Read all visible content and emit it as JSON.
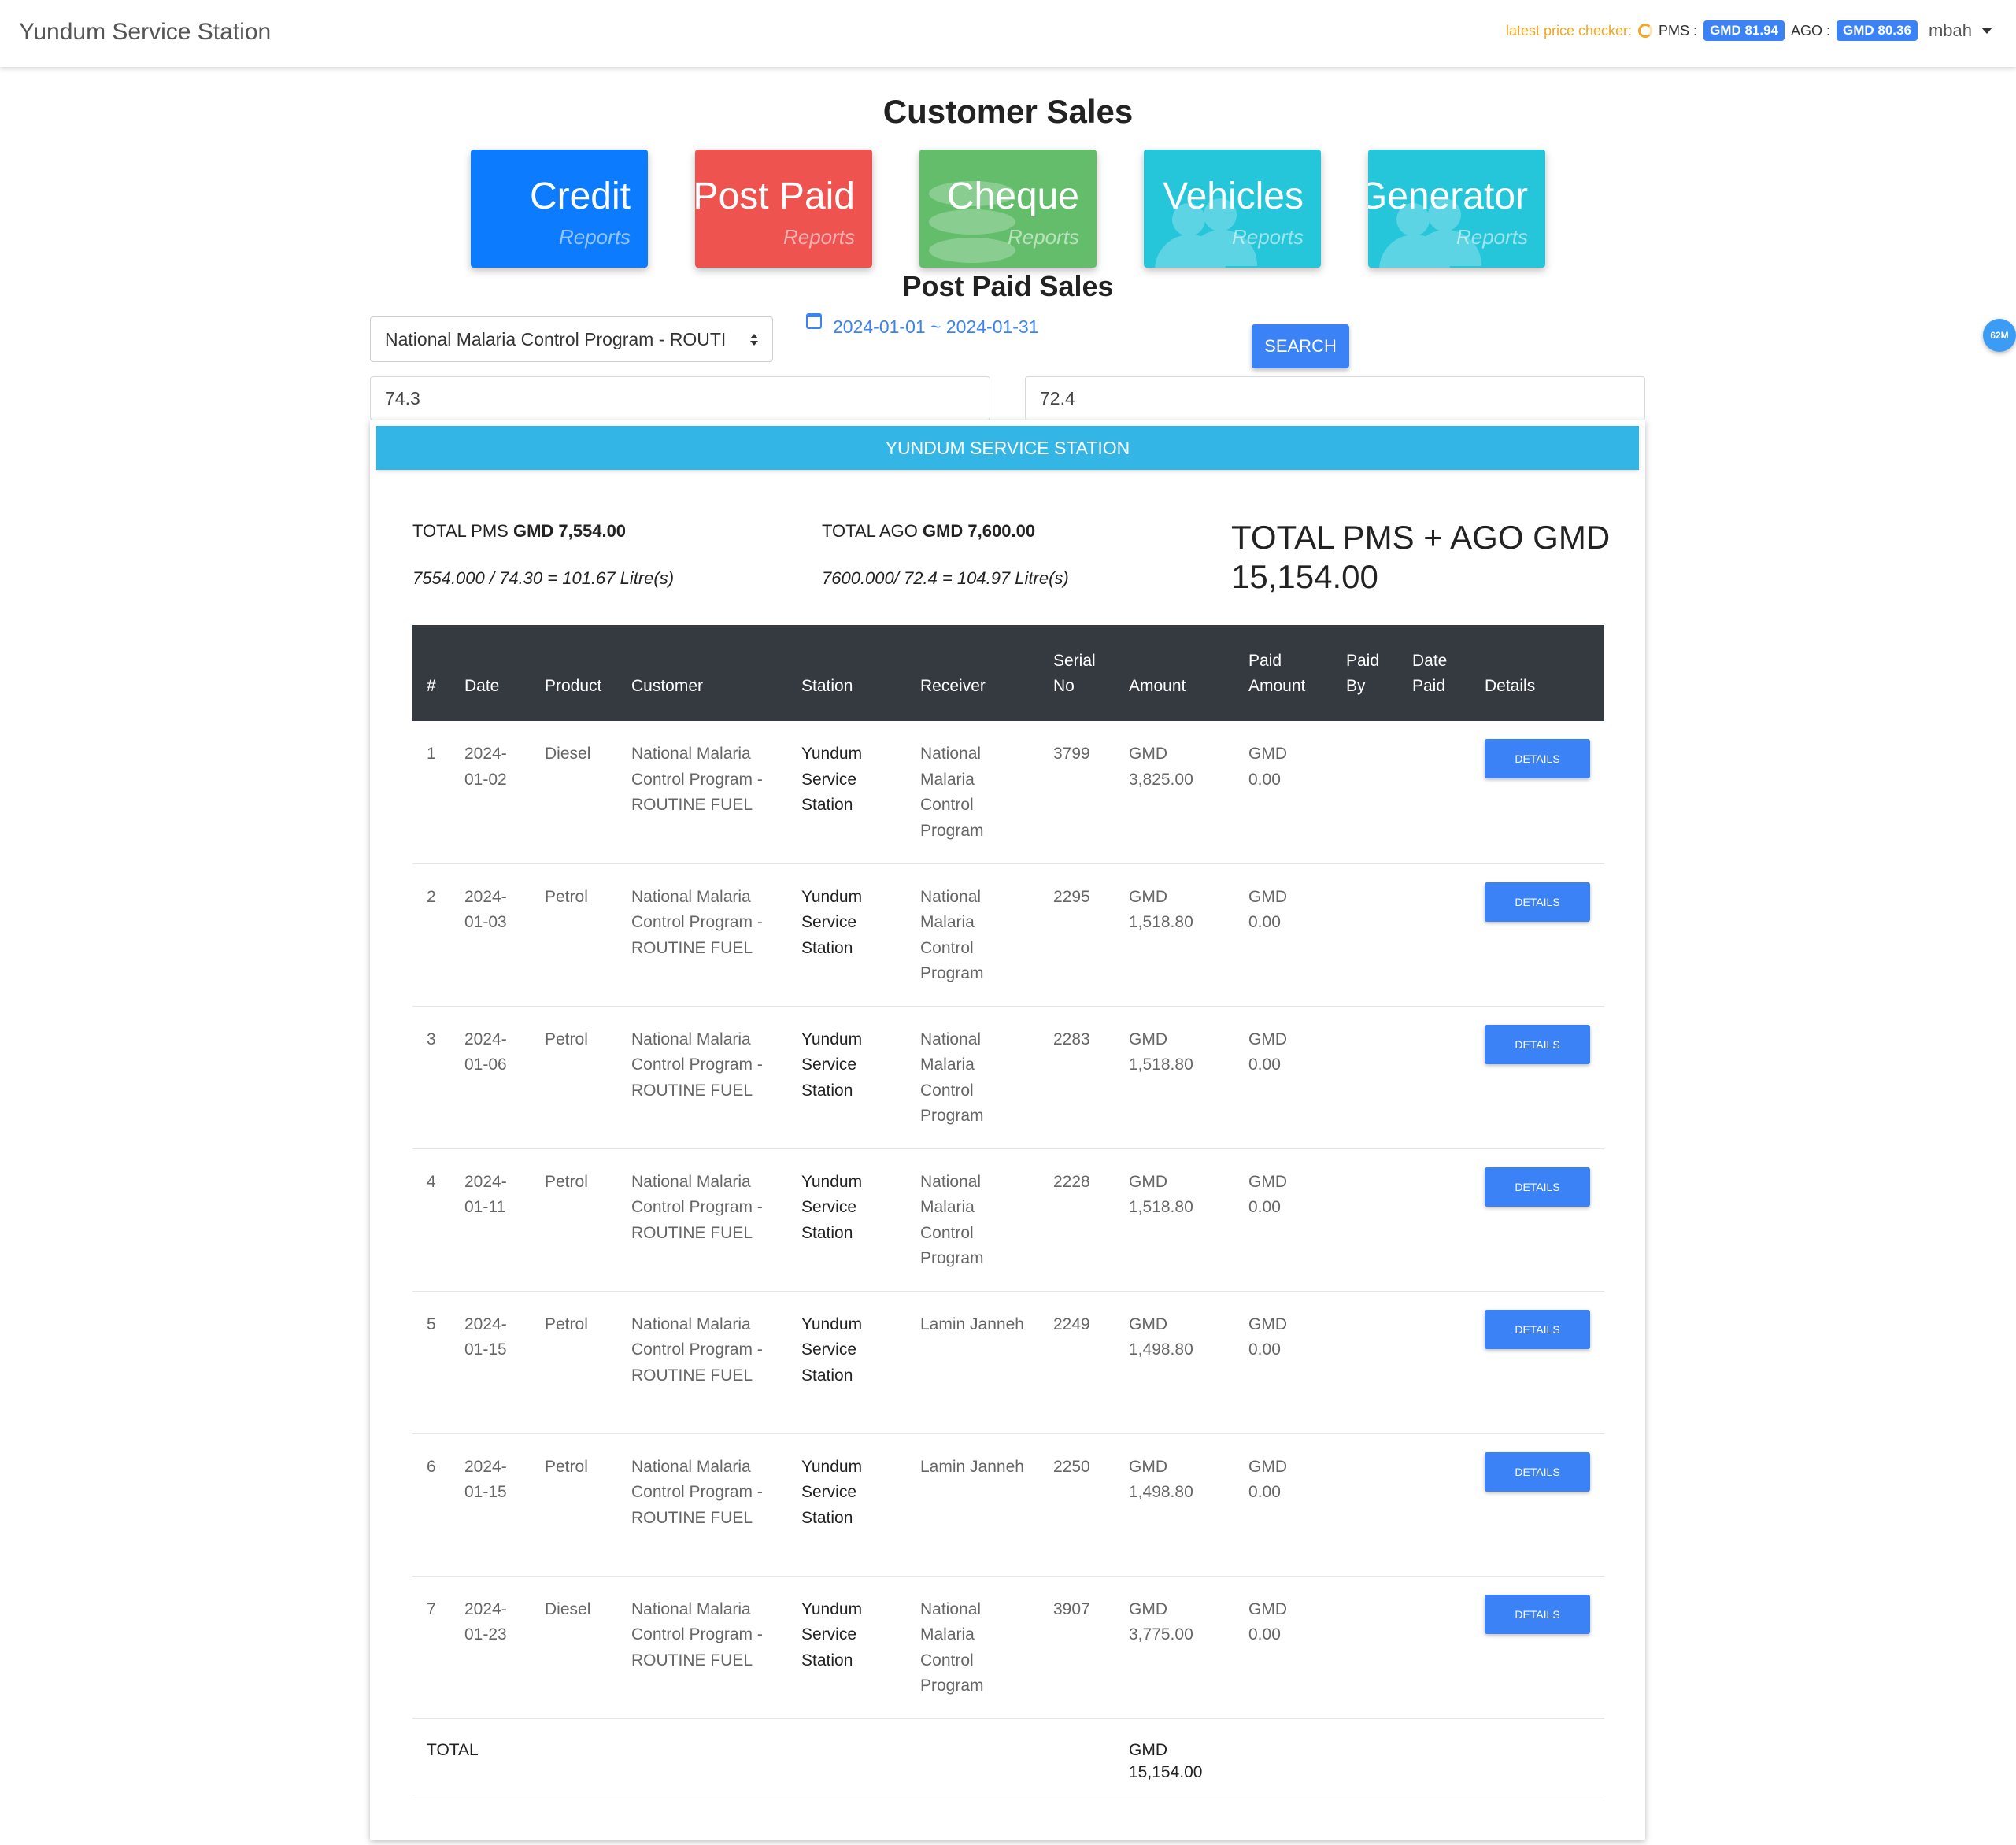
{
  "navbar": {
    "brand": "Yundum Service Station",
    "price_checker_label": "latest price checker:",
    "pms_label": "PMS :",
    "pms_price": "GMD 81.94",
    "ago_label": "AGO :",
    "ago_price": "GMD 80.36",
    "user": "mbah"
  },
  "page_title": "Customer Sales",
  "cards": [
    {
      "title": "Credit",
      "subtitle": "Reports",
      "color": "#0d7bfe"
    },
    {
      "title": "Post Paid",
      "subtitle": "Reports",
      "color": "#ef5350"
    },
    {
      "title": "Cheque",
      "subtitle": "Reports",
      "color": "#63bd6b",
      "icon": "coins-icon"
    },
    {
      "title": "Vehicles",
      "subtitle": "Reports",
      "color": "#26c6da",
      "icon": "users-icon"
    },
    {
      "title": "Generator",
      "subtitle": "Reports",
      "color": "#26c6da",
      "icon": "users-icon"
    }
  ],
  "section_title": "Post Paid Sales",
  "filters": {
    "customer_selected": "National Malaria Control Program - ROUTI",
    "date_range": "2024-01-01 ~ 2024-01-31",
    "search_label": "SEARCH",
    "pms_rate": "74.3",
    "ago_rate": "72.4"
  },
  "memory_badge": "62M",
  "report": {
    "station_header": "YUNDUM SERVICE STATION",
    "total_pms_label": "TOTAL PMS",
    "total_pms_value": "GMD 7,554.00",
    "total_ago_label": "TOTAL AGO",
    "total_ago_value": "GMD 7,600.00",
    "pms_formula": "7554.000 / 74.30 = 101.67 Litre(s)",
    "ago_formula": "7600.000/ 72.4 = 104.97 Litre(s)",
    "grand_total_label": "TOTAL PMS + AGO GMD",
    "grand_total_value": "15,154.00"
  },
  "table": {
    "headers": [
      "#",
      "Date",
      "Product",
      "Customer",
      "Station",
      "Receiver",
      "Serial No",
      "Amount",
      "Paid Amount",
      "Paid By",
      "Date Paid",
      "Details"
    ],
    "details_label": "DETAILS",
    "rows": [
      {
        "n": "1",
        "date": "2024-01-02",
        "product": "Diesel",
        "customer": "National Malaria Control Program - ROUTINE FUEL",
        "station": "Yundum Service Station",
        "receiver": "National Malaria Control Program",
        "serial": "3799",
        "amount": "GMD 3,825.00",
        "paid": "GMD 0.00",
        "paid_by": "",
        "date_paid": ""
      },
      {
        "n": "2",
        "date": "2024-01-03",
        "product": "Petrol",
        "customer": "National Malaria Control Program - ROUTINE FUEL",
        "station": "Yundum Service Station",
        "receiver": "National Malaria Control Program",
        "serial": "2295",
        "amount": "GMD 1,518.80",
        "paid": "GMD 0.00",
        "paid_by": "",
        "date_paid": ""
      },
      {
        "n": "3",
        "date": "2024-01-06",
        "product": "Petrol",
        "customer": "National Malaria Control Program - ROUTINE FUEL",
        "station": "Yundum Service Station",
        "receiver": "National Malaria Control Program",
        "serial": "2283",
        "amount": "GMD 1,518.80",
        "paid": "GMD 0.00",
        "paid_by": "",
        "date_paid": ""
      },
      {
        "n": "4",
        "date": "2024-01-11",
        "product": "Petrol",
        "customer": "National Malaria Control Program - ROUTINE FUEL",
        "station": "Yundum Service Station",
        "receiver": "National Malaria Control Program",
        "serial": "2228",
        "amount": "GMD 1,518.80",
        "paid": "GMD 0.00",
        "paid_by": "",
        "date_paid": ""
      },
      {
        "n": "5",
        "date": "2024-01-15",
        "product": "Petrol",
        "customer": "National Malaria Control Program - ROUTINE FUEL",
        "station": "Yundum Service Station",
        "receiver": "Lamin Janneh",
        "serial": "2249",
        "amount": "GMD 1,498.80",
        "paid": "GMD 0.00",
        "paid_by": "",
        "date_paid": ""
      },
      {
        "n": "6",
        "date": "2024-01-15",
        "product": "Petrol",
        "customer": "National Malaria Control Program - ROUTINE FUEL",
        "station": "Yundum Service Station",
        "receiver": "Lamin Janneh",
        "serial": "2250",
        "amount": "GMD 1,498.80",
        "paid": "GMD 0.00",
        "paid_by": "",
        "date_paid": ""
      },
      {
        "n": "7",
        "date": "2024-01-23",
        "product": "Diesel",
        "customer": "National Malaria Control Program - ROUTINE FUEL",
        "station": "Yundum Service Station",
        "receiver": "National Malaria Control Program",
        "serial": "3907",
        "amount": "GMD 3,775.00",
        "paid": "GMD 0.00",
        "paid_by": "",
        "date_paid": ""
      }
    ],
    "total_label": "TOTAL",
    "total_amount": "GMD 15,154.00"
  }
}
